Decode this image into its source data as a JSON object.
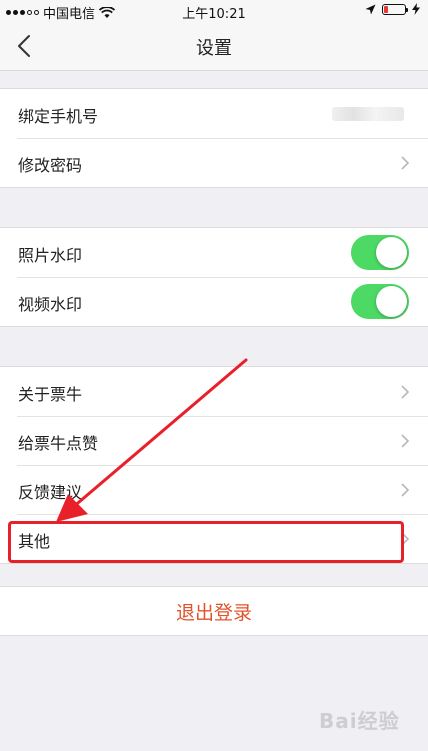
{
  "status_bar": {
    "carrier": "中国电信",
    "time": "上午10:21"
  },
  "nav": {
    "title": "设置"
  },
  "account_group": {
    "items": [
      {
        "label": "绑定手机号"
      },
      {
        "label": "修改密码"
      }
    ]
  },
  "watermark_group": {
    "items": [
      {
        "label": "照片水印",
        "enabled": true
      },
      {
        "label": "视频水印",
        "enabled": true
      }
    ]
  },
  "about_group": {
    "items": [
      {
        "label": "关于票牛"
      },
      {
        "label": "给票牛点赞"
      },
      {
        "label": "反馈建议"
      },
      {
        "label": "其他"
      }
    ]
  },
  "logout": {
    "label": "退出登录"
  },
  "colors": {
    "switch_on": "#4cd964",
    "logout_text": "#e0552d",
    "annotation_red": "#e8202a"
  },
  "watermark": {
    "text": "Bai经验"
  }
}
